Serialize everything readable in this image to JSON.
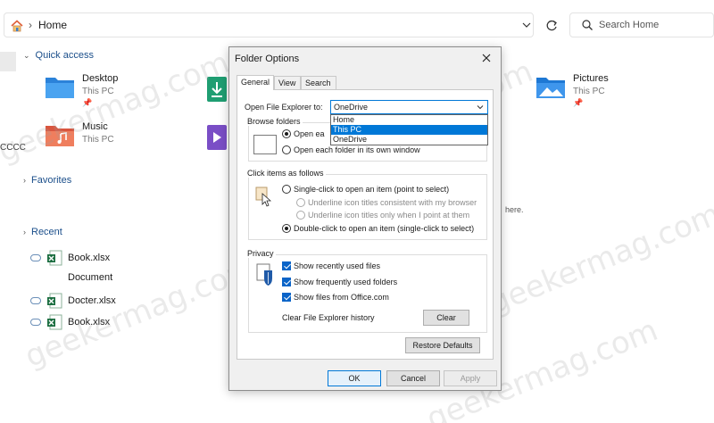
{
  "address_bar": {
    "location": "Home",
    "search_placeholder": "Search Home"
  },
  "sidebar": {
    "quick_access": "Quick access",
    "favorites": "Favorites",
    "recent": "Recent",
    "truncated_text": "CCCC"
  },
  "quick_access_tiles": [
    {
      "name": "Desktop",
      "sub": "This PC"
    },
    {
      "name": "Music",
      "sub": "This PC"
    },
    {
      "name": "Pictures",
      "sub": "This PC"
    }
  ],
  "recent_files": [
    {
      "name": "Book.xlsx"
    },
    {
      "name": "Document"
    },
    {
      "name": "Docter.xlsx"
    },
    {
      "name": "Book.xlsx"
    }
  ],
  "background_fragments": {
    "here_text": "here."
  },
  "watermark": "geekermag.com",
  "dialog": {
    "title": "Folder Options",
    "tabs": [
      "General",
      "View",
      "Search"
    ],
    "open_label": "Open File Explorer to:",
    "open_value": "OneDrive",
    "dropdown_options": [
      "Home",
      "This PC",
      "OneDrive"
    ],
    "dropdown_selected": "This PC",
    "browse_folders": {
      "title": "Browse folders",
      "opt_same": "Open ea",
      "opt_own": "Open each folder in its own window"
    },
    "click_items": {
      "title": "Click items as follows",
      "single": "Single-click to open an item (point to select)",
      "underline_browser": "Underline icon titles consistent with my browser",
      "underline_point": "Underline icon titles only when I point at them",
      "double": "Double-click to open an item (single-click to select)"
    },
    "privacy": {
      "title": "Privacy",
      "recent_files": "Show recently used files",
      "frequent_folders": "Show frequently used folders",
      "office_files": "Show files from Office.com",
      "clear_label": "Clear File Explorer history",
      "clear_button": "Clear"
    },
    "restore_defaults": "Restore Defaults",
    "ok": "OK",
    "cancel": "Cancel",
    "apply": "Apply"
  },
  "colors": {
    "accent": "#0078d7",
    "link_blue": "#1a4e8a",
    "excel_green": "#1d6f42"
  }
}
